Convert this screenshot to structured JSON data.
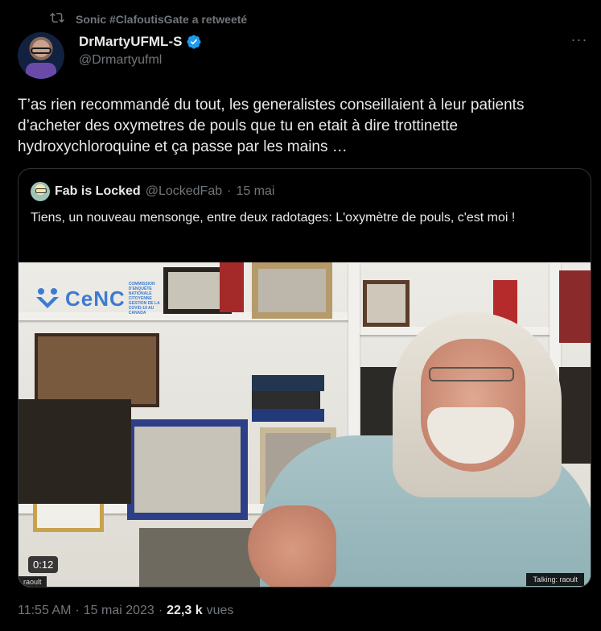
{
  "retweet": {
    "label": "Sonic #ClafoutisGate a retweeté"
  },
  "author": {
    "name": "DrMartyUFML-S",
    "handle": "@Drmartyufml",
    "verified": true
  },
  "tweet": {
    "text": "T’as rien recommandé du tout, les generalistes conseillaient à leur patients d’acheter des oxymetres de pouls que tu en etait à dire trottinette hydroxychloroquine et ça passe par les mains …"
  },
  "quote": {
    "name": "Fab is Locked",
    "handle": "@LockedFab",
    "separator": "·",
    "date": "15 mai",
    "text": "Tiens, un nouveau mensonge, entre deux radotages: L'oxymètre de pouls, c'est moi !"
  },
  "video": {
    "timestamp": "0:12",
    "overlay_logo": "CeNC",
    "overlay_logo_sub": "COMMISSION D'ENQUÊTE NATIONALE CITOYENNE",
    "overlay_logo_sub2": "GESTION DE LA COVID-19 AU CANADA",
    "participant_label": "raoult",
    "talking_label": "Talking: raoult"
  },
  "footer": {
    "time": "11:55 AM",
    "separator": "·",
    "date": "15 mai 2023",
    "separator2": "·",
    "views_count": "22,3 k",
    "views_label": "vues"
  },
  "colors": {
    "background": "#000000",
    "text_primary": "#e7e9ea",
    "text_secondary": "#71767b",
    "verified_blue": "#1d9bf0",
    "border": "#2f3336"
  }
}
